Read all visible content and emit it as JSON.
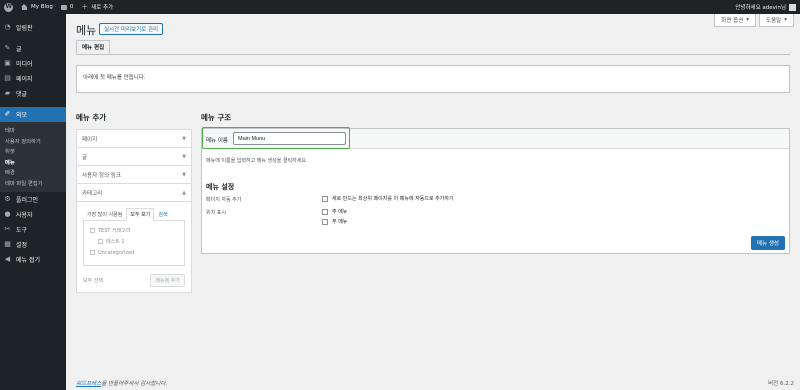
{
  "admin_bar": {
    "site_name": "My Blog",
    "comments_count": "0",
    "new_label": "새로 추가",
    "greeting": "안녕하세요 adevin님"
  },
  "sidebar": {
    "items": [
      {
        "label": "알림판",
        "icon": "dashboard-icon"
      },
      {
        "label": "글",
        "icon": "pin-icon"
      },
      {
        "label": "미디어",
        "icon": "media-icon"
      },
      {
        "label": "페이지",
        "icon": "page-icon"
      },
      {
        "label": "댓글",
        "icon": "comment-icon"
      },
      {
        "label": "외모",
        "icon": "appearance-icon",
        "current": true
      },
      {
        "label": "플러그인",
        "icon": "plugin-icon"
      },
      {
        "label": "사용자",
        "icon": "users-icon"
      },
      {
        "label": "도구",
        "icon": "tools-icon"
      },
      {
        "label": "설정",
        "icon": "settings-icon"
      },
      {
        "label": "메뉴 접기",
        "icon": "collapse-icon"
      }
    ],
    "appearance_submenu": [
      "테마",
      "사용자 정의하기",
      "위젯",
      "메뉴",
      "배경",
      "테마 파일 편집기"
    ],
    "current_submenu": "메뉴"
  },
  "screen_tabs": {
    "screen_options": "화면 옵션",
    "help": "도움말"
  },
  "page": {
    "title": "메뉴",
    "live_preview_button": "실시간 미리보기로 관리",
    "tab_edit": "메뉴 편집",
    "notice": "아래에 첫 메뉴를 만듭니다."
  },
  "add_menu_items": {
    "heading": "메뉴 추가",
    "sections": [
      "페이지",
      "글",
      "사용자 정의 링크",
      "카테고리"
    ],
    "category_tabs": [
      "가장 많이 사용됨",
      "모두 보기",
      "검색"
    ],
    "active_tab": "모두 보기",
    "categories": [
      "TEST 카테고리",
      "테스트 1",
      "Uncategorized"
    ],
    "select_all": "모두 선택",
    "add_button": "메뉴에 추가"
  },
  "menu_structure": {
    "heading": "메뉴 구조",
    "name_label": "메뉴 이름",
    "name_value": "Main Munu",
    "instructions": "메뉴에 이름을 입력하고 메뉴 생성을 클릭하세요.",
    "settings_title": "메뉴 설정",
    "auto_add_label": "페이지 자동 추가",
    "auto_add_option": "새로 만드는 최상위 페이지를 이 메뉴에 자동으로 추가하기",
    "display_location_label": "위치 표시",
    "locations": [
      "주 메뉴",
      "푸 메뉴"
    ],
    "create_button": "메뉴 생성"
  },
  "footer": {
    "link_text": "워드프레스",
    "thanks_text": "를 만들어주셔서 감사합니다.",
    "version": "버전 6.2.2"
  },
  "colors": {
    "admin_dark": "#1d2327",
    "accent": "#2271b1",
    "highlight_box": "#4caf50"
  }
}
